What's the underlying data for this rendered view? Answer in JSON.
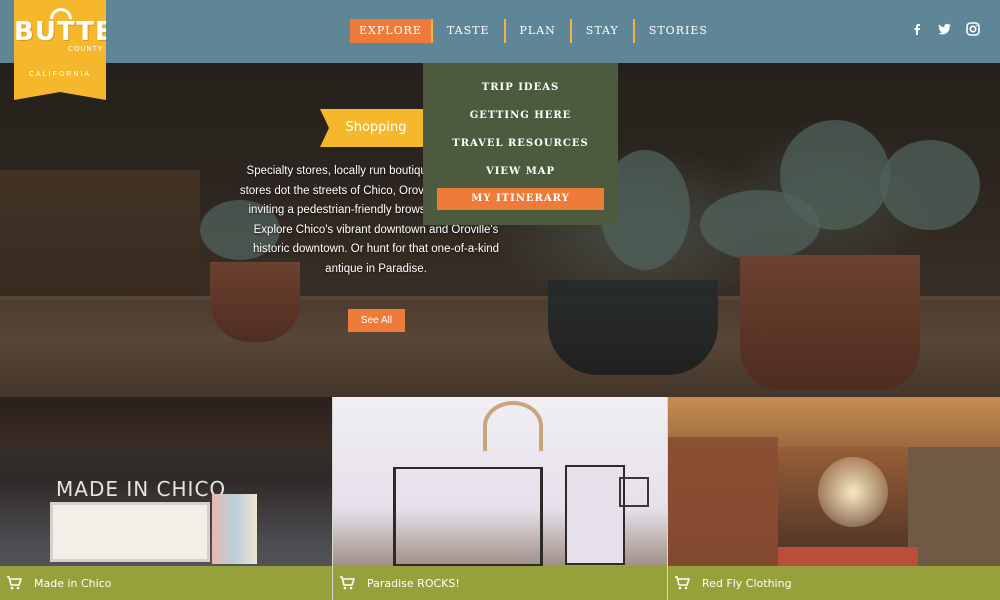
{
  "brand": {
    "logo_word_1": "BUTTE",
    "logo_word_2": "COUNTY",
    "logo_sub": "CALIFORNIA"
  },
  "nav": {
    "items": [
      {
        "label": "EXPLORE",
        "active": true
      },
      {
        "label": "TASTE",
        "active": false
      },
      {
        "label": "PLAN",
        "active": false
      },
      {
        "label": "STAY",
        "active": false
      },
      {
        "label": "STORIES",
        "active": false
      }
    ]
  },
  "social": {
    "icons": [
      "facebook-icon",
      "twitter-icon",
      "instagram-icon"
    ]
  },
  "dropdown": {
    "items": [
      {
        "label": "TRIP IDEAS",
        "highlight": false
      },
      {
        "label": "GETTING HERE",
        "highlight": false
      },
      {
        "label": "TRAVEL RESOURCES",
        "highlight": false
      },
      {
        "label": "VIEW MAP",
        "highlight": false
      },
      {
        "label": "MY ITINERARY",
        "highlight": true
      }
    ]
  },
  "feature": {
    "heading": "Shopping",
    "blurb": "Specialty stores, locally run boutiques, and antique stores dot the streets of Chico, Oroville and Paradise, inviting a pedestrian-friendly browsing and buying. Explore Chico's vibrant downtown and Oroville's historic downtown. Or hunt for that one-of-a-kind antique in Paradise.",
    "cta": "See All"
  },
  "tiles": [
    {
      "name": "Made in Chico",
      "sign": "MADE IN CHICO"
    },
    {
      "name": "Paradise ROCKS!"
    },
    {
      "name": "Red Fly Clothing"
    }
  ],
  "colors": {
    "topbar": "#5f8696",
    "accent_orange": "#ee7b3a",
    "logo_yellow": "#f5b72b",
    "dropdown_bg": "#4c5a3d",
    "tile_label_bg": "#96a13b"
  }
}
